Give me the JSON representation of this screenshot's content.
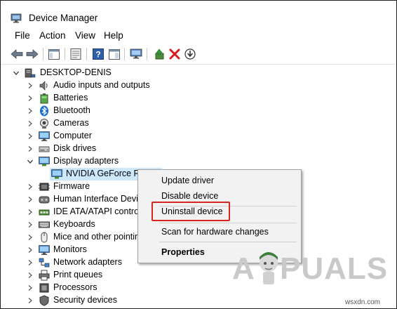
{
  "window": {
    "title": "Device Manager"
  },
  "menu": [
    "File",
    "Action",
    "View",
    "Help"
  ],
  "toolbar": {
    "icons": [
      "back-arrow-icon",
      "forward-arrow-icon",
      "properties-icon",
      "show-hide-console-tree-icon",
      "help-icon",
      "action-pane-icon",
      "monitor-icon",
      "update-driver-icon",
      "uninstall-x-icon",
      "scan-hardware-icon"
    ]
  },
  "tree": {
    "root": "DESKTOP-DENIS",
    "items": [
      {
        "label": "Audio inputs and outputs",
        "icon": "speaker-icon",
        "expanded": false
      },
      {
        "label": "Batteries",
        "icon": "battery-icon",
        "expanded": false
      },
      {
        "label": "Bluetooth",
        "icon": "bluetooth-icon",
        "expanded": false
      },
      {
        "label": "Cameras",
        "icon": "camera-icon",
        "expanded": false
      },
      {
        "label": "Computer",
        "icon": "computer-icon",
        "expanded": false
      },
      {
        "label": "Disk drives",
        "icon": "disk-icon",
        "expanded": false
      },
      {
        "label": "Display adapters",
        "icon": "display-adapter-icon",
        "expanded": true
      },
      {
        "label": "NVIDIA GeForce RT",
        "icon": "gpu-icon",
        "child": true,
        "selected": true
      },
      {
        "label": "Firmware",
        "icon": "firmware-icon",
        "expanded": false
      },
      {
        "label": "Human Interface Devic",
        "icon": "hid-icon",
        "expanded": false
      },
      {
        "label": "IDE ATA/ATAPI controll",
        "icon": "ide-icon",
        "expanded": false
      },
      {
        "label": "Keyboards",
        "icon": "keyboard-icon",
        "expanded": false
      },
      {
        "label": "Mice and other pointin",
        "icon": "mouse-icon",
        "expanded": false
      },
      {
        "label": "Monitors",
        "icon": "monitor-icon",
        "expanded": false
      },
      {
        "label": "Network adapters",
        "icon": "network-icon",
        "expanded": false
      },
      {
        "label": "Print queues",
        "icon": "printer-icon",
        "expanded": false
      },
      {
        "label": "Processors",
        "icon": "processor-icon",
        "expanded": false
      },
      {
        "label": "Security devices",
        "icon": "security-icon",
        "expanded": false
      }
    ]
  },
  "context_menu": {
    "items": [
      {
        "label": "Update driver",
        "bold": false
      },
      {
        "label": "Disable device",
        "bold": false
      },
      {
        "label": "Uninstall device",
        "bold": false,
        "highlighted": true
      },
      {
        "label": "Scan for hardware changes",
        "bold": false
      },
      {
        "label": "Properties",
        "bold": true
      }
    ]
  },
  "watermark": {
    "left": "A",
    "right": "PUALS"
  },
  "credit": "wsxdn.com",
  "colors": {
    "selection": "#cce8ff",
    "highlight_border": "#d7261e",
    "menu_bg": "#f2f2f2",
    "watermark": "#c9c9c9"
  }
}
